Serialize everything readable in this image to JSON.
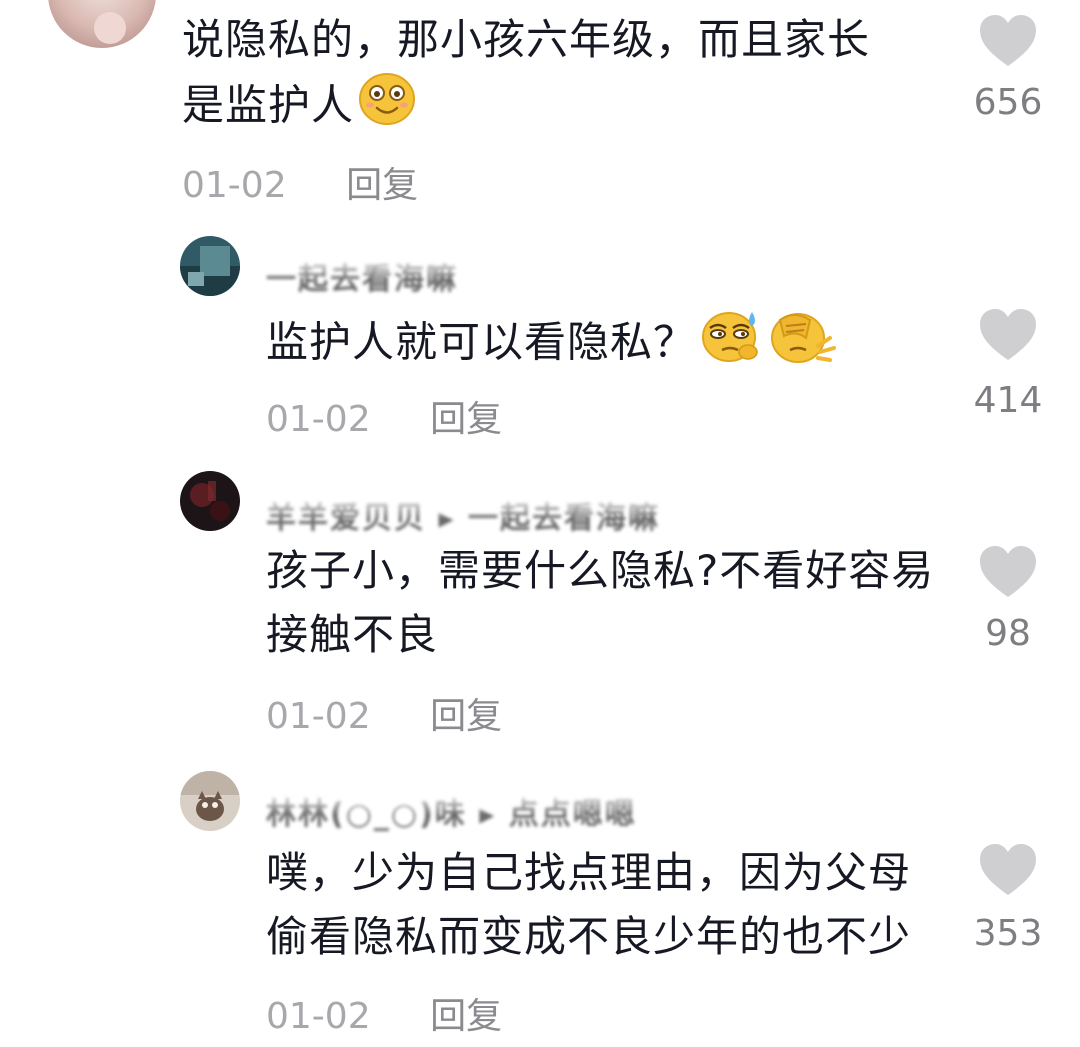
{
  "comments": [
    {
      "username": "",
      "text_lines": [
        "说隐私的，那小孩六年级，而且家长",
        "是监护人"
      ],
      "emoji": [
        "smiley-emoji"
      ],
      "date": "01-02",
      "reply_label": "回复",
      "likes": "656",
      "avatar_icon": "avatar-image"
    },
    {
      "username": "一起去看海嘛",
      "text_lines": [
        "监护人就可以看隐私？"
      ],
      "emoji": [
        "sweat-smirk-emoji",
        "facepalm-emoji"
      ],
      "date": "01-02",
      "reply_label": "回复",
      "likes": "414",
      "avatar_icon": "avatar-image"
    },
    {
      "username": "羊羊爱贝贝 ▸ 一起去看海嘛",
      "text_lines": [
        "孩子小，需要什么隐私?不看好容易",
        "接触不良"
      ],
      "emoji": [],
      "date": "01-02",
      "reply_label": "回复",
      "likes": "98",
      "avatar_icon": "avatar-image"
    },
    {
      "username": "林林(○_○)味 ▸ 点点嗯嗯",
      "text_lines": [
        "噗，少为自己找点理由，因为父母",
        "偷看隐私而变成不良少年的也不少"
      ],
      "emoji": [],
      "date": "01-02",
      "reply_label": "回复",
      "likes": "353",
      "avatar_icon": "avatar-image"
    }
  ],
  "colors": {
    "text": "#161823",
    "meta": "#a8a8ac",
    "like_icon": "#cfcfd2",
    "like_count": "#7d7d82"
  },
  "icons": {
    "like": "heart-icon"
  }
}
